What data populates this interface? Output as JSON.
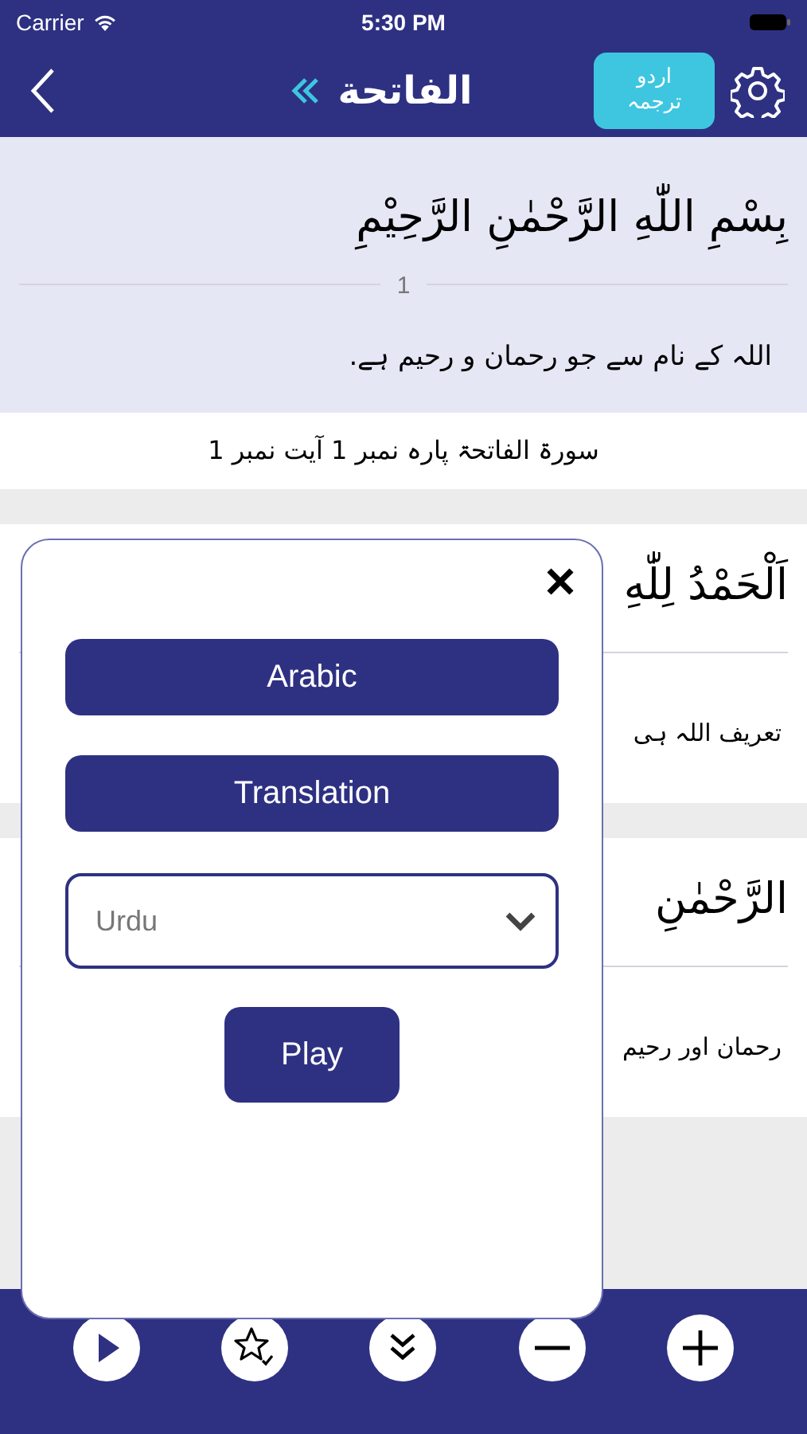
{
  "status_bar": {
    "carrier": "Carrier",
    "time": "5:30 PM"
  },
  "nav": {
    "title": "الفاتحة",
    "language_badge": [
      "اردو",
      "ترجمہ"
    ]
  },
  "verses": [
    {
      "arabic": "بِسْمِ اللّٰهِ الرَّحْمٰنِ الرَّحِيْمِ",
      "number": "1",
      "translation": "اللہ کے نام سے جو رحمان و رحیم ہے.",
      "highlighted": true,
      "reference": "سورۃ الفاتحۃ پارہ نمبر 1 آیت نمبر 1"
    },
    {
      "arabic": "اَلْحَمْدُ لِلّٰهِ",
      "translation": "تعریف اللہ ہی",
      "highlighted": false
    },
    {
      "arabic": "الرَّحْمٰنِ",
      "translation": "رحمان اور رحیم",
      "highlighted": false
    }
  ],
  "popup": {
    "buttons": [
      "Arabic",
      "Translation"
    ],
    "language_select": {
      "value": "Urdu"
    },
    "play_button": "Play"
  }
}
